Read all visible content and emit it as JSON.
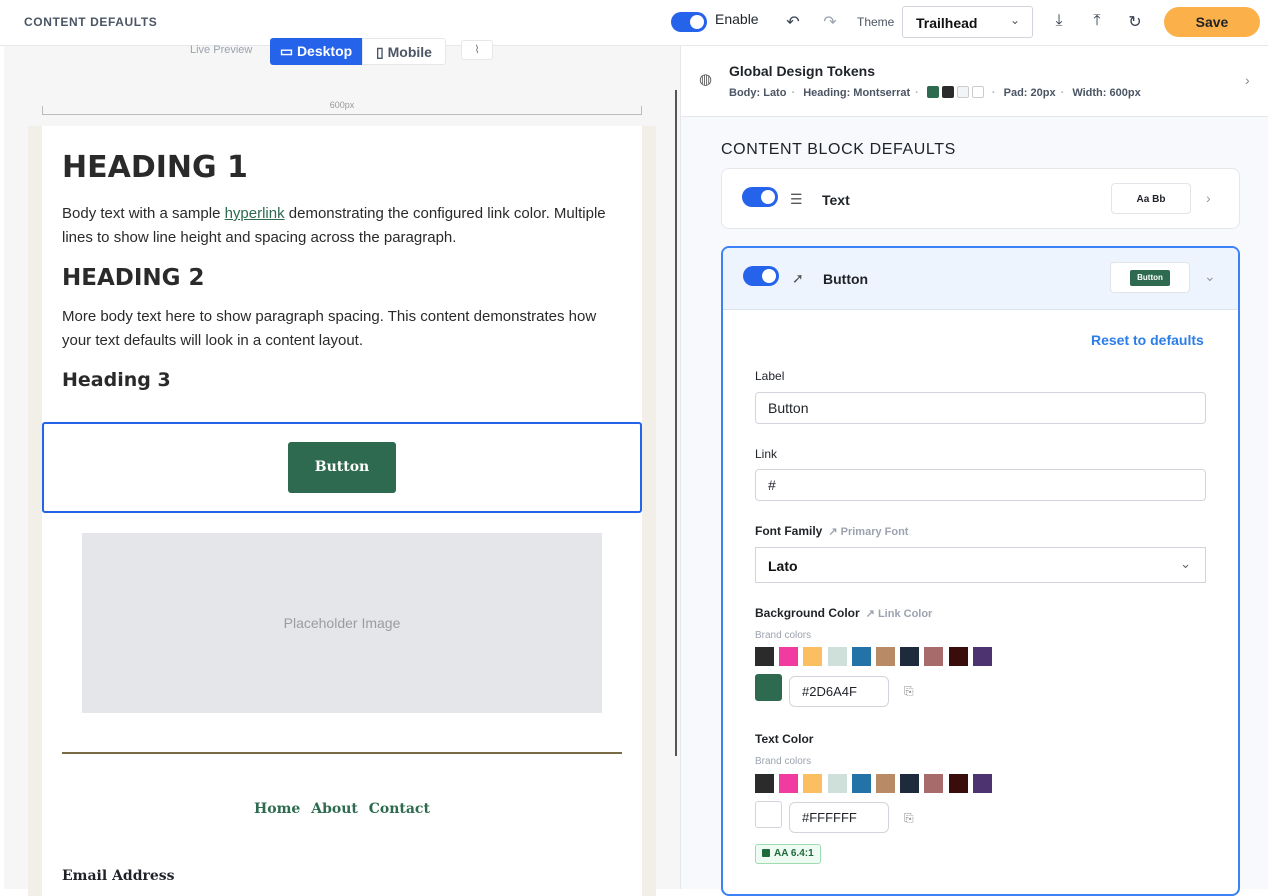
{
  "header": {
    "title": "CONTENT DEFAULTS",
    "enable_label": "Enable",
    "theme_label": "Theme",
    "theme_value": "Trailhead",
    "save_label": "Save"
  },
  "preview": {
    "live_preview_label": "Live Preview",
    "desktop_label": "Desktop",
    "mobile_label": "Mobile",
    "ruler_label": "600px",
    "heading1": "HEADING 1",
    "para1_before": "Body text with a sample ",
    "para1_link": "hyperlink",
    "para1_after": " demonstrating the configured link color. Multiple lines to show line height and spacing across the paragraph.",
    "heading2": "HEADING 2",
    "para2": "More body text here to show paragraph spacing. This content demonstrates how your text defaults will look in a content layout.",
    "heading3": "Heading 3",
    "button_label": "Button",
    "placeholder_label": "Placeholder Image",
    "nav": [
      "Home",
      "About",
      "Contact"
    ],
    "email_label": "Email Address"
  },
  "tokens": {
    "title": "Global Design Tokens",
    "body": "Body: Lato",
    "heading": "Heading: Montserrat",
    "swatches": [
      "#2d6a4f",
      "#2b2b2b",
      "#f3f4f6",
      "#ffffff"
    ],
    "pad": "Pad: 20px",
    "width": "Width: 600px"
  },
  "blocks": {
    "section_title": "CONTENT BLOCK DEFAULTS",
    "text_block": {
      "label": "Text",
      "preview": "Aa Bb",
      "enabled": true
    },
    "button_block": {
      "label": "Button",
      "preview": "Button",
      "enabled": true,
      "reset_label": "Reset to defaults",
      "label_field": {
        "label": "Label",
        "value": "Button"
      },
      "link_field": {
        "label": "Link",
        "value": "#"
      },
      "font_family": {
        "label": "Font Family",
        "ref": "Primary Font",
        "value": "Lato"
      },
      "background_color": {
        "label": "Background Color",
        "ref": "Link Color",
        "brand_label": "Brand colors",
        "value": "#2D6A4F",
        "swatch": "#2d6a4f"
      },
      "text_color": {
        "label": "Text Color",
        "brand_label": "Brand colors",
        "value": "#FFFFFF",
        "swatch": "#ffffff"
      },
      "contrast_badge": "AA 6.4:1"
    }
  },
  "brand_colors": [
    "#2b2b2b",
    "#f23ba0",
    "#fbbf62",
    "#cfe0db",
    "#2373a8",
    "#b98a66",
    "#1e2b3c",
    "#a86b6b",
    "#3a0d0d",
    "#4d3470"
  ],
  "accent": "#2563eb"
}
